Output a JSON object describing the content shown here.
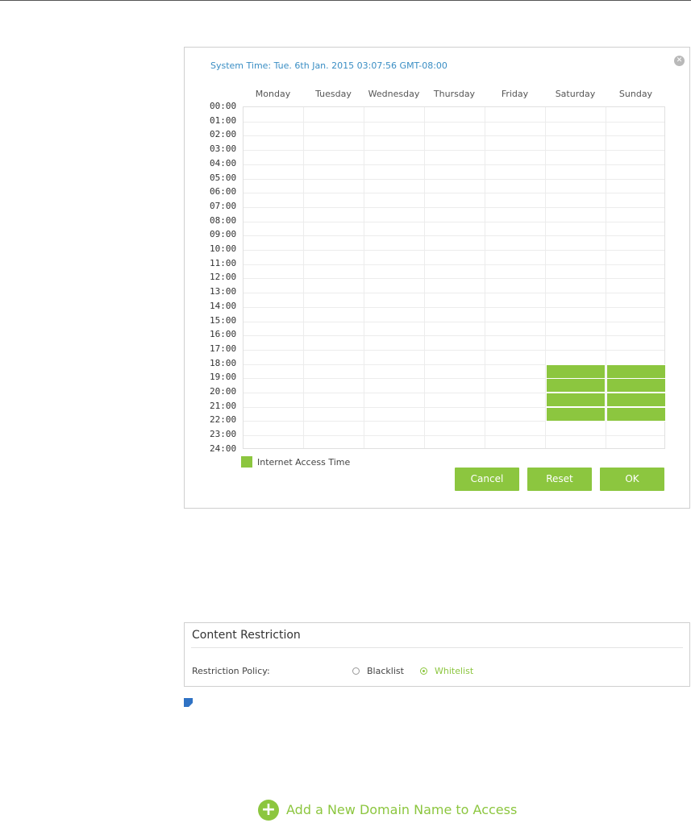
{
  "schedule": {
    "system_time": "System Time: Tue. 6th Jan. 2015 03:07:56 GMT-08:00",
    "close_icon": "close-icon",
    "days": [
      "Monday",
      "Tuesday",
      "Wednesday",
      "Thursday",
      "Friday",
      "Saturday",
      "Sunday"
    ],
    "hours": [
      "00:00",
      "01:00",
      "02:00",
      "03:00",
      "04:00",
      "05:00",
      "06:00",
      "07:00",
      "08:00",
      "09:00",
      "10:00",
      "11:00",
      "12:00",
      "13:00",
      "14:00",
      "15:00",
      "16:00",
      "17:00",
      "18:00",
      "19:00",
      "20:00",
      "21:00",
      "22:00",
      "23:00",
      "24:00"
    ],
    "selected_slots": [
      {
        "day": "Saturday",
        "hour": 18
      },
      {
        "day": "Saturday",
        "hour": 19
      },
      {
        "day": "Saturday",
        "hour": 20
      },
      {
        "day": "Saturday",
        "hour": 21
      },
      {
        "day": "Sunday",
        "hour": 18
      },
      {
        "day": "Sunday",
        "hour": 19
      },
      {
        "day": "Sunday",
        "hour": 20
      },
      {
        "day": "Sunday",
        "hour": 21
      }
    ],
    "legend_label": "Internet Access Time",
    "legend_color": "#8cc63f",
    "buttons": {
      "cancel": "Cancel",
      "reset": "Reset",
      "ok": "OK"
    }
  },
  "content_restriction": {
    "title": "Content Restriction",
    "policy_label": "Restriction Policy:",
    "options": [
      {
        "label": "Blacklist",
        "checked": false
      },
      {
        "label": "Whitelist",
        "checked": true
      }
    ]
  },
  "note_icon": "note-icon",
  "add_domain": {
    "icon": "plus-circle-icon",
    "label": "Add a New Domain Name to Access"
  },
  "colors": {
    "accent": "#8cc63f",
    "link": "#3a8ec4",
    "note": "#2f72c4"
  }
}
